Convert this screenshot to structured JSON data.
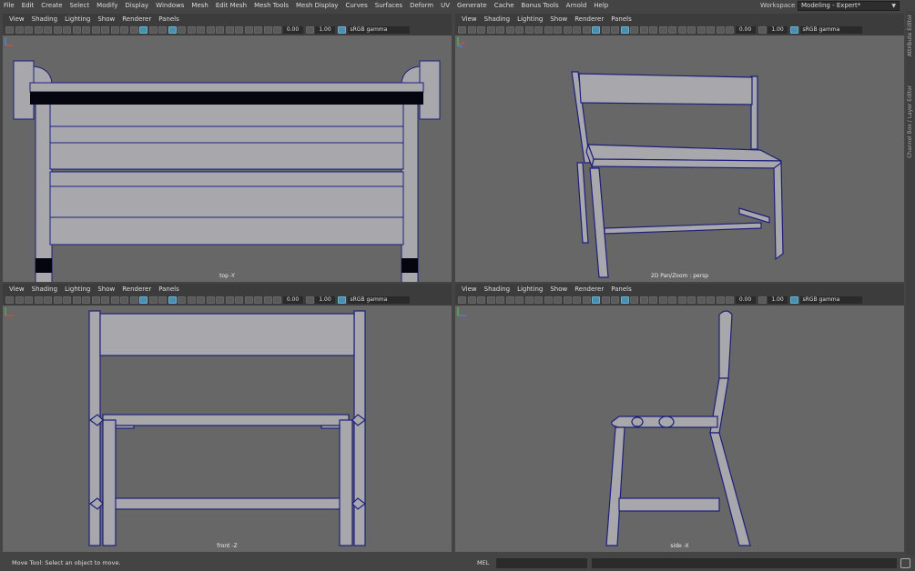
{
  "menubar": {
    "items": [
      "File",
      "Edit",
      "Create",
      "Select",
      "Modify",
      "Display",
      "Windows",
      "Mesh",
      "Edit Mesh",
      "Mesh Tools",
      "Mesh Display",
      "Curves",
      "Surfaces",
      "Deform",
      "UV",
      "Generate",
      "Cache",
      "Bonus Tools",
      "Arnold",
      "Help"
    ]
  },
  "workspace": {
    "label": "Workspace :",
    "value": "Modeling - Expert*"
  },
  "viewport_menu": [
    "View",
    "Shading",
    "Lighting",
    "Show",
    "Renderer",
    "Panels"
  ],
  "viewport_toolbar": {
    "exposure": "0.00",
    "gamma": "1.00",
    "colorspace": "sRGB gamma"
  },
  "viewports": {
    "top": {
      "label": "top -Y"
    },
    "persp": {
      "label": "2D Pan/Zoom : persp"
    },
    "front": {
      "label": "front -Z"
    },
    "side": {
      "label": "side -X"
    }
  },
  "status": {
    "text": "Move Tool: Select an object to move."
  },
  "command_line": {
    "label": "MEL"
  },
  "side_tabs": {
    "attribute_editor": "Attribute Editor",
    "channel_box": "Channel Box / Layer Editor"
  },
  "colors": {
    "wireframe": "#1d1f7a",
    "mesh_fill": "#a8a8ac",
    "viewport_bg": "#676767",
    "active_tool": "#4a8fae"
  }
}
